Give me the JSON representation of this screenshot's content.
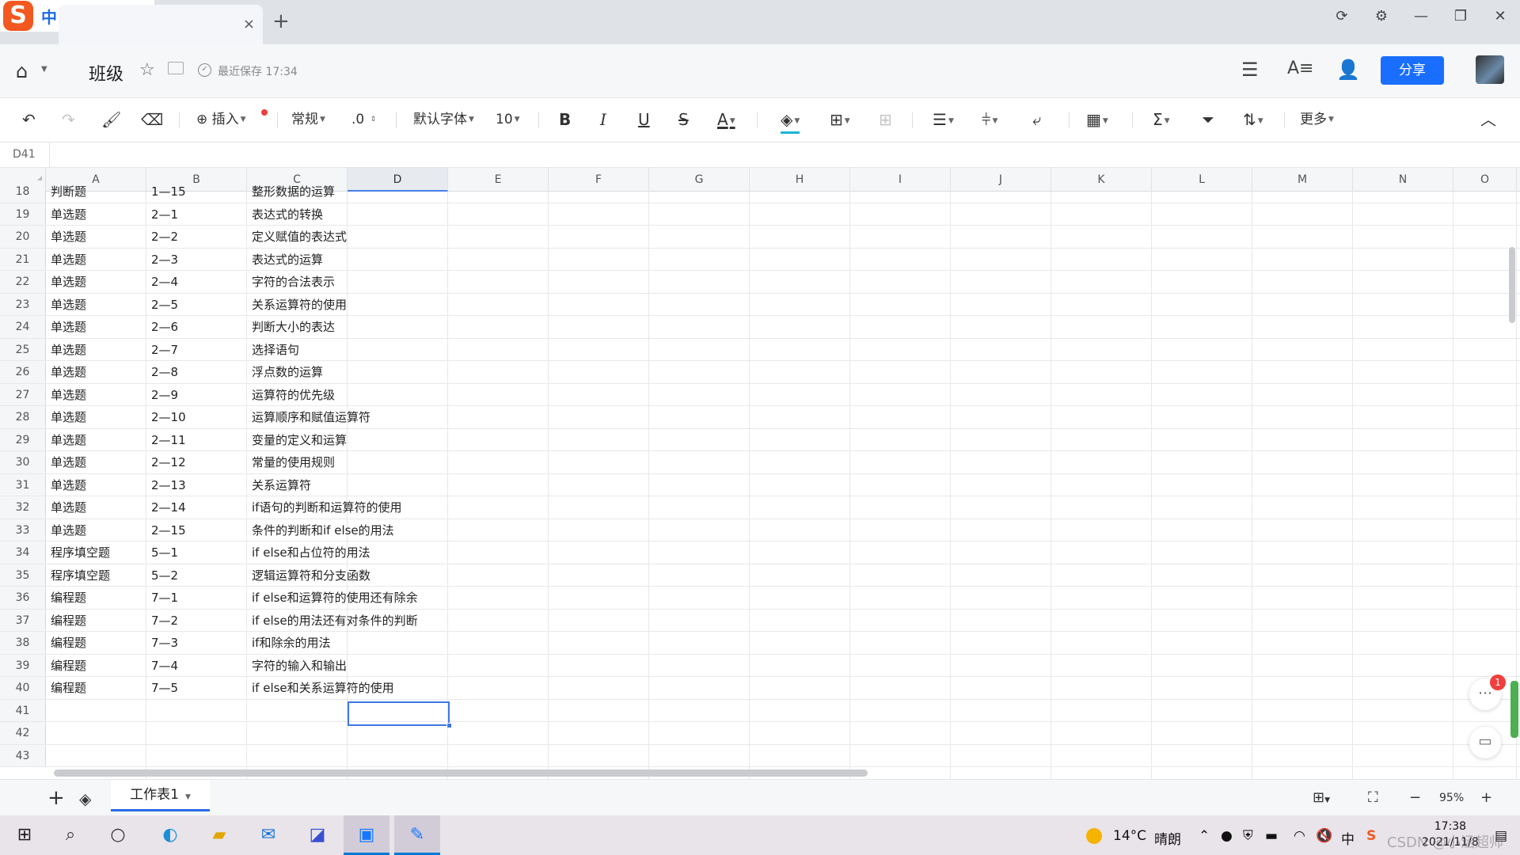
{
  "browser": {
    "ime": {
      "lang": "中"
    },
    "new_tab": "+",
    "tab_close": "×",
    "window_controls": [
      "⟳",
      "⚙",
      "—",
      "❐",
      "✕"
    ]
  },
  "header": {
    "doc_title": "班级",
    "save_status": "最近保存 17:34",
    "share_label": "分享"
  },
  "toolbar": {
    "insert": "插入",
    "format": "常规",
    "decimal": ".0",
    "font": "默认字体",
    "font_size": "10",
    "bold": "B",
    "italic": "I",
    "underline": "U",
    "strike": "S",
    "font_color": "A",
    "sum": "Σ",
    "more": "更多"
  },
  "formula_bar": {
    "cell_ref": "D41"
  },
  "columns": [
    "A",
    "B",
    "C",
    "D",
    "E",
    "F",
    "G",
    "H",
    "I",
    "J",
    "K",
    "L",
    "M",
    "N",
    "O"
  ],
  "active_column": "D",
  "rows": [
    {
      "n": "18",
      "a": "判断题",
      "b": "1—15",
      "c": "整形数据的运算"
    },
    {
      "n": "19",
      "a": "单选题",
      "b": "2—1",
      "c": " 表达式的转换"
    },
    {
      "n": "20",
      "a": "单选题",
      "b": "2—2",
      "c": "定义赋值的表达式"
    },
    {
      "n": "21",
      "a": "单选题",
      "b": "2—3",
      "c": "表达式的运算"
    },
    {
      "n": "22",
      "a": "单选题",
      "b": "2—4",
      "c": "字符的合法表示"
    },
    {
      "n": "23",
      "a": "单选题",
      "b": "2—5",
      "c": "关系运算符的使用"
    },
    {
      "n": "24",
      "a": "单选题",
      "b": "2—6",
      "c": "判断大小的表达"
    },
    {
      "n": "25",
      "a": "单选题",
      "b": "2—7",
      "c": "选择语句"
    },
    {
      "n": "26",
      "a": "单选题",
      "b": "2—8",
      "c": "浮点数的运算"
    },
    {
      "n": "27",
      "a": "单选题",
      "b": "2—9",
      "c": "运算符的优先级"
    },
    {
      "n": "28",
      "a": "单选题",
      "b": "2—10",
      "c": "运算顺序和赋值运算符"
    },
    {
      "n": "29",
      "a": "单选题",
      "b": "2—11",
      "c": "变量的定义和运算"
    },
    {
      "n": "30",
      "a": "单选题",
      "b": "2—12",
      "c": "常量的使用规则"
    },
    {
      "n": "31",
      "a": "单选题",
      "b": "2—13",
      "c": "关系运算符"
    },
    {
      "n": "32",
      "a": "单选题",
      "b": "2—14",
      "c": "if语句的判断和运算符的使用"
    },
    {
      "n": "33",
      "a": "单选题",
      "b": "2—15",
      "c": "条件的判断和if else的用法"
    },
    {
      "n": "34",
      "a": "程序填空题",
      "b": "5—1",
      "c": "if else和占位符的用法"
    },
    {
      "n": "35",
      "a": "程序填空题",
      "b": "5—2",
      "c": "逻辑运算符和分支函数"
    },
    {
      "n": "36",
      "a": "编程题",
      "b": "7—1",
      "c": "if else和运算符的使用还有除余"
    },
    {
      "n": "37",
      "a": "编程题",
      "b": "7—2",
      "c": "if else的用法还有对条件的判断"
    },
    {
      "n": "38",
      "a": "编程题",
      "b": "7—3",
      "c": "if和除余的用法"
    },
    {
      "n": "39",
      "a": "编程题",
      "b": "7—4",
      "c": "字符的输入和输出"
    },
    {
      "n": "40",
      "a": " 编程题",
      "b": "7—5",
      "c": "if else和关系运算符的使用"
    },
    {
      "n": "41",
      "a": "",
      "b": "",
      "c": ""
    },
    {
      "n": "42",
      "a": "",
      "b": "",
      "c": ""
    },
    {
      "n": "43",
      "a": "",
      "b": "",
      "c": ""
    }
  ],
  "side_badge": "1",
  "sheetbar": {
    "sheet_name": "工作表1",
    "zoom": "95%"
  },
  "taskbar": {
    "temperature": "14°C",
    "weather": "晴朗",
    "time": "17:38",
    "date": "2021/11/8",
    "ime_lang": "中"
  },
  "watermark": "CSDN @小涵超帅",
  "colors": {
    "accent": "#1a6eff",
    "selection": "#3f77e8"
  }
}
